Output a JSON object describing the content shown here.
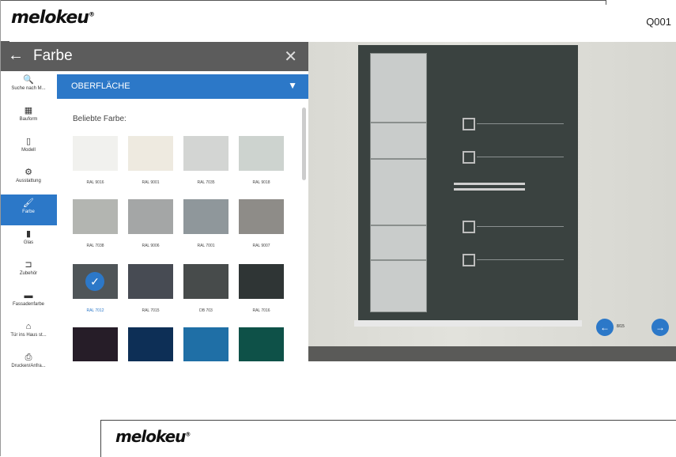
{
  "header": {
    "logo_text": "melokeu",
    "logo_mark": "®",
    "code": "Q001"
  },
  "panel": {
    "back_label": "←",
    "title": "Farbe",
    "close_label": "✕"
  },
  "sidebar": {
    "items": [
      {
        "icon": "search-icon",
        "glyph": "🔍",
        "label": "Suche nach M..."
      },
      {
        "icon": "door-style-icon",
        "glyph": "▦",
        "label": "Bauform"
      },
      {
        "icon": "door-model-icon",
        "glyph": "▯",
        "label": "Modell"
      },
      {
        "icon": "gear-icon",
        "glyph": "⚙",
        "label": "Ausstattung"
      },
      {
        "icon": "paint-icon",
        "glyph": "🖌",
        "label": "Farbe"
      },
      {
        "icon": "glass-icon",
        "glyph": "▮",
        "label": "Glas"
      },
      {
        "icon": "handle-icon",
        "glyph": "⊐",
        "label": "Zubehör"
      },
      {
        "icon": "facade-icon",
        "glyph": "▬",
        "label": "Fassadenfarbe"
      },
      {
        "icon": "house-icon",
        "glyph": "⌂",
        "label": "Tür ins Haus st..."
      },
      {
        "icon": "print-icon",
        "glyph": "⎙",
        "label": "Drucken/Anfra..."
      }
    ]
  },
  "content": {
    "dropdown_label": "OBERFLÄCHE",
    "dropdown_arrow": "▼",
    "section_title": "Beliebte Farbe:",
    "swatches": [
      {
        "label": "RAL 9016",
        "color": "#f1f1ee"
      },
      {
        "label": "RAL 9001",
        "color": "#eeeae0"
      },
      {
        "label": "RAL 7035",
        "color": "#d3d5d3"
      },
      {
        "label": "RAL 9018",
        "color": "#cdd3cf"
      },
      {
        "label": "RAL 7038",
        "color": "#b3b5b1"
      },
      {
        "label": "RAL 9006",
        "color": "#a4a6a6"
      },
      {
        "label": "RAL 7001",
        "color": "#8f979b"
      },
      {
        "label": "RAL 9007",
        "color": "#8e8c88"
      },
      {
        "label": "RAL 7012",
        "color": "#4f5558"
      },
      {
        "label": "RAL 7015",
        "color": "#474b53"
      },
      {
        "label": "DB 703",
        "color": "#474b4b"
      },
      {
        "label": "RAL 7016",
        "color": "#2f3535"
      },
      {
        "label": "",
        "color": "#261d28"
      },
      {
        "label": "",
        "color": "#0d2f56"
      },
      {
        "label": "",
        "color": "#1f6fa6"
      },
      {
        "label": "",
        "color": "#0e5148"
      }
    ],
    "selected_index": 8
  },
  "pager": {
    "prev": "←",
    "next": "→",
    "count": "8/15"
  },
  "bottom": {
    "logo_text": "melokeu",
    "logo_mark": "®"
  }
}
